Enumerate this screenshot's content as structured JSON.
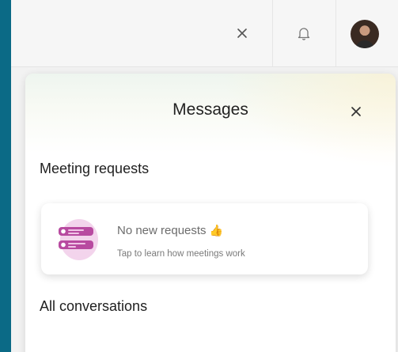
{
  "topbar": {
    "close_icon": "close-icon",
    "bell_icon": "bell-icon",
    "avatar_icon": "user-avatar"
  },
  "messages": {
    "title": "Messages",
    "close_icon": "close-icon",
    "meeting_requests_heading": "Meeting requests",
    "request_card": {
      "title": "No new requests",
      "title_emoji": "👍",
      "subtitle": "Tap to learn how meetings work"
    },
    "all_conversations_heading": "All conversations"
  },
  "colors": {
    "outer_background": "#0b6a86",
    "card_accent": "#b84aa0",
    "card_accent_light": "#e6a7d8"
  }
}
